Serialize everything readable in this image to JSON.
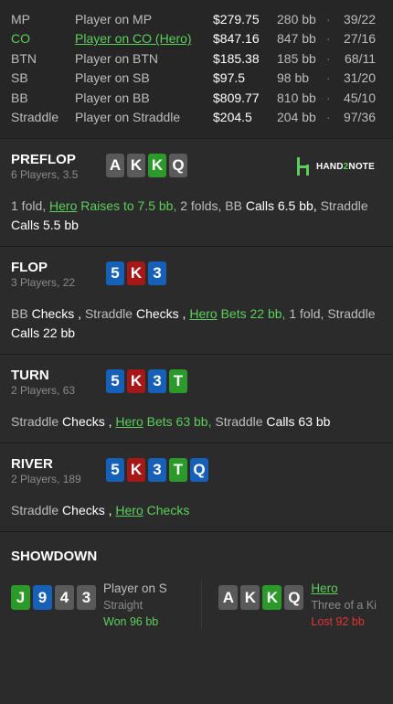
{
  "players": [
    {
      "pos": "MP",
      "name": "Player on MP",
      "stack": "$279.75",
      "bb": "280 bb",
      "sep": "·",
      "vpip": "39/22",
      "hero": false
    },
    {
      "pos": "CO",
      "name": "Player on CO (Hero)",
      "stack": "$847.16",
      "bb": "847 bb",
      "sep": "·",
      "vpip": "27/16",
      "hero": true
    },
    {
      "pos": "BTN",
      "name": "Player on BTN",
      "stack": "$185.38",
      "bb": "185 bb",
      "sep": "·",
      "vpip": "68/11",
      "hero": false
    },
    {
      "pos": "SB",
      "name": "Player on SB",
      "stack": "$97.5",
      "bb": "98 bb",
      "sep": "·",
      "vpip": "31/20",
      "hero": false
    },
    {
      "pos": "BB",
      "name": "Player on BB",
      "stack": "$809.77",
      "bb": "810 bb",
      "sep": "·",
      "vpip": "45/10",
      "hero": false
    },
    {
      "pos": "Straddle",
      "name": "Player on Straddle",
      "stack": "$204.5",
      "bb": "204 bb",
      "sep": "·",
      "vpip": "97/36",
      "hero": false
    }
  ],
  "logo": {
    "text1": "HAND",
    "text2": "2",
    "text3": "NOTE"
  },
  "streets": [
    {
      "id": "preflop",
      "name": "PREFLOP",
      "sub": "6 Players, 3.5",
      "cards": [
        {
          "r": "A",
          "s": "s"
        },
        {
          "r": "K",
          "s": "s"
        },
        {
          "r": "K",
          "s": "c"
        },
        {
          "r": "Q",
          "s": "s"
        }
      ],
      "actions": [
        {
          "type": "plain",
          "text": "1 fold, "
        },
        {
          "type": "hero",
          "name": "Hero",
          "text": " Raises to 7.5 bb, "
        },
        {
          "type": "plain",
          "text": "2 folds, "
        },
        {
          "type": "nm",
          "text": "BB "
        },
        {
          "type": "act",
          "text": "Calls 6.5 bb, "
        },
        {
          "type": "nm",
          "text": "Straddle "
        },
        {
          "type": "act",
          "text": "Calls 5.5 bb"
        }
      ]
    },
    {
      "id": "flop",
      "name": "FLOP",
      "sub": "3 Players, 22",
      "cards": [
        {
          "r": "5",
          "s": "d"
        },
        {
          "r": "K",
          "s": "h"
        },
        {
          "r": "3",
          "s": "d"
        }
      ],
      "actions": [
        {
          "type": "nm",
          "text": "BB "
        },
        {
          "type": "act",
          "text": "Checks , "
        },
        {
          "type": "nm",
          "text": "Straddle "
        },
        {
          "type": "act",
          "text": "Checks , "
        },
        {
          "type": "hero",
          "name": "Hero",
          "text": " Bets 22 bb, "
        },
        {
          "type": "plain",
          "text": "1 fold, "
        },
        {
          "type": "nm",
          "text": "Straddle "
        },
        {
          "type": "act",
          "text": "Calls 22 bb"
        }
      ]
    },
    {
      "id": "turn",
      "name": "TURN",
      "sub": "2 Players, 63",
      "cards": [
        {
          "r": "5",
          "s": "d"
        },
        {
          "r": "K",
          "s": "h"
        },
        {
          "r": "3",
          "s": "d"
        },
        {
          "r": "T",
          "s": "c"
        }
      ],
      "actions": [
        {
          "type": "nm",
          "text": "Straddle "
        },
        {
          "type": "act",
          "text": "Checks , "
        },
        {
          "type": "hero",
          "name": "Hero",
          "text": " Bets 63 bb, "
        },
        {
          "type": "nm",
          "text": "Straddle "
        },
        {
          "type": "act",
          "text": "Calls 63 bb"
        }
      ]
    },
    {
      "id": "river",
      "name": "RIVER",
      "sub": "2 Players, 189",
      "cards": [
        {
          "r": "5",
          "s": "d"
        },
        {
          "r": "K",
          "s": "h"
        },
        {
          "r": "3",
          "s": "d"
        },
        {
          "r": "T",
          "s": "c"
        },
        {
          "r": "Q",
          "s": "d"
        }
      ],
      "actions": [
        {
          "type": "nm",
          "text": "Straddle "
        },
        {
          "type": "act",
          "text": "Checks , "
        },
        {
          "type": "hero",
          "name": "Hero",
          "text": " Checks"
        }
      ]
    }
  ],
  "showdown": {
    "title": "SHOWDOWN",
    "hands": [
      {
        "cards": [
          {
            "r": "J",
            "s": "c"
          },
          {
            "r": "9",
            "s": "d"
          },
          {
            "r": "4",
            "s": "s"
          },
          {
            "r": "3",
            "s": "s"
          }
        ],
        "who": "Player on S",
        "hero": false,
        "hand": "Straight",
        "result": "Won 96 bb",
        "won": true
      },
      {
        "cards": [
          {
            "r": "A",
            "s": "s"
          },
          {
            "r": "K",
            "s": "s"
          },
          {
            "r": "K",
            "s": "c"
          },
          {
            "r": "Q",
            "s": "s"
          }
        ],
        "who": "Hero",
        "hero": true,
        "hand": "Three of a Ki",
        "result": "Lost 92 bb",
        "won": false
      }
    ]
  }
}
